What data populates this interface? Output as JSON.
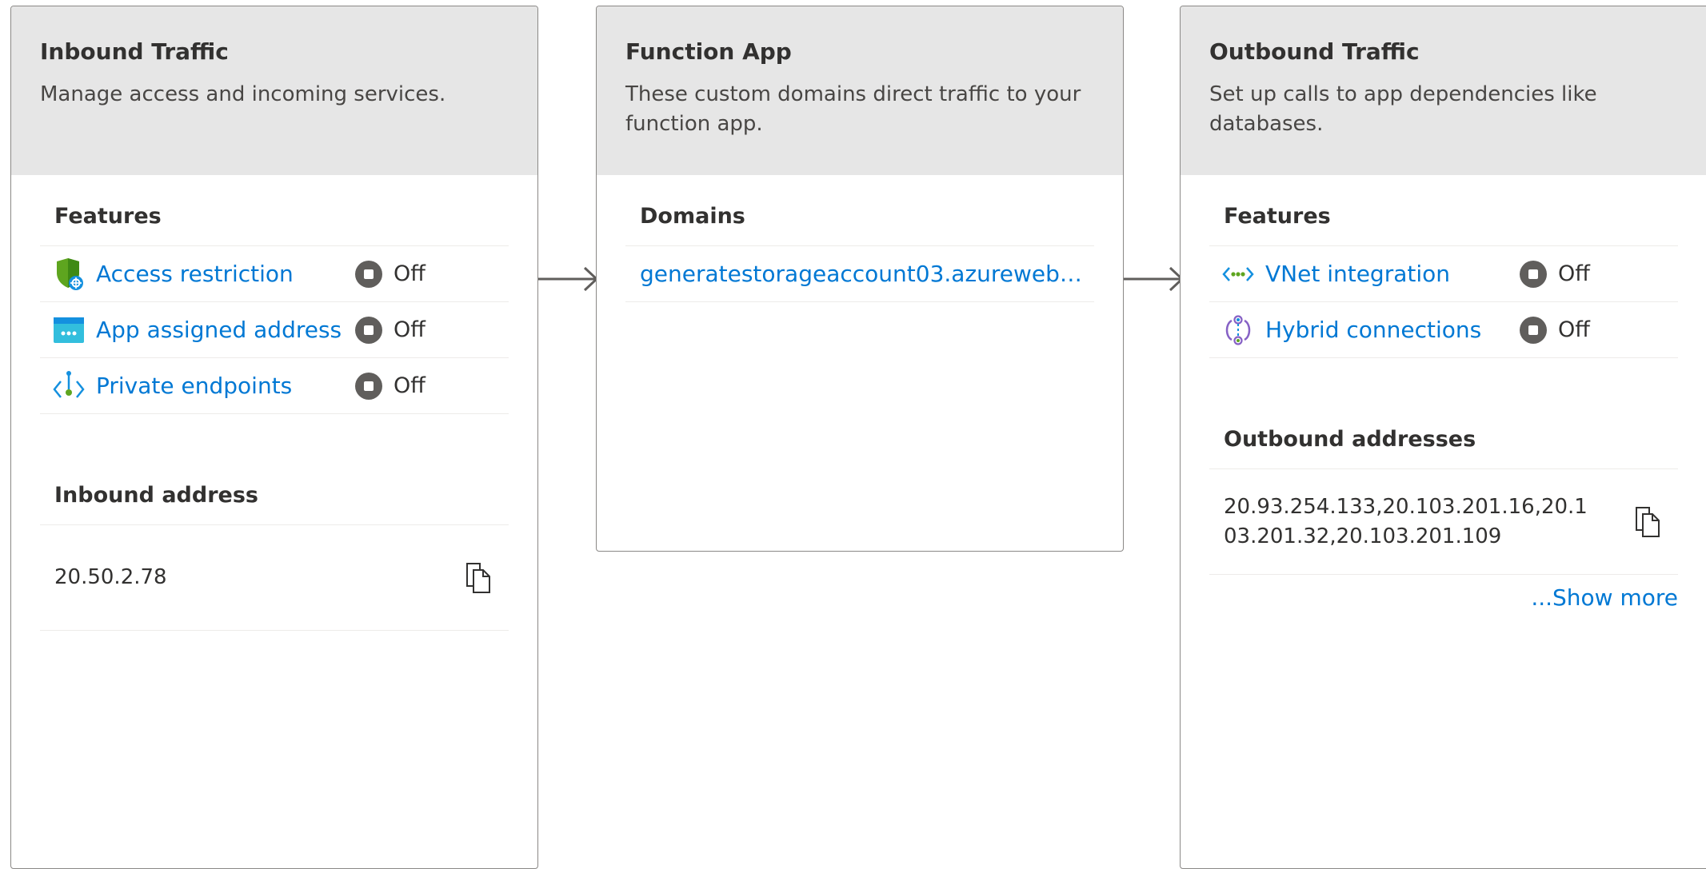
{
  "inbound": {
    "title": "Inbound Traffic",
    "description": "Manage access and incoming services.",
    "features_heading": "Features",
    "features": [
      {
        "label": "Access restriction",
        "status": "Off",
        "icon": "shield-icon"
      },
      {
        "label": "App assigned address",
        "status": "Off",
        "icon": "address-icon"
      },
      {
        "label": "Private endpoints",
        "status": "Off",
        "icon": "private-endpoint-icon"
      }
    ],
    "address_heading": "Inbound address",
    "address": "20.50.2.78"
  },
  "function_app": {
    "title": "Function App",
    "description": "These custom domains direct traffic to your function app.",
    "domains_heading": "Domains",
    "domain": "generatestorageaccount03.azurewebsites.net"
  },
  "outbound": {
    "title": "Outbound Traffic",
    "description": "Set up calls to app dependencies like databases.",
    "features_heading": "Features",
    "features": [
      {
        "label": "VNet integration",
        "status": "Off",
        "icon": "vnet-icon"
      },
      {
        "label": "Hybrid connections",
        "status": "Off",
        "icon": "hybrid-connection-icon"
      }
    ],
    "addresses_heading": "Outbound addresses",
    "addresses": "20.93.254.133,20.103.201.16,20.103.201.32,20.103.201.109",
    "show_more": "...Show more"
  },
  "colors": {
    "link": "#0078d4",
    "header_bg": "#e6e6e6",
    "status_off": "#605e5c"
  }
}
